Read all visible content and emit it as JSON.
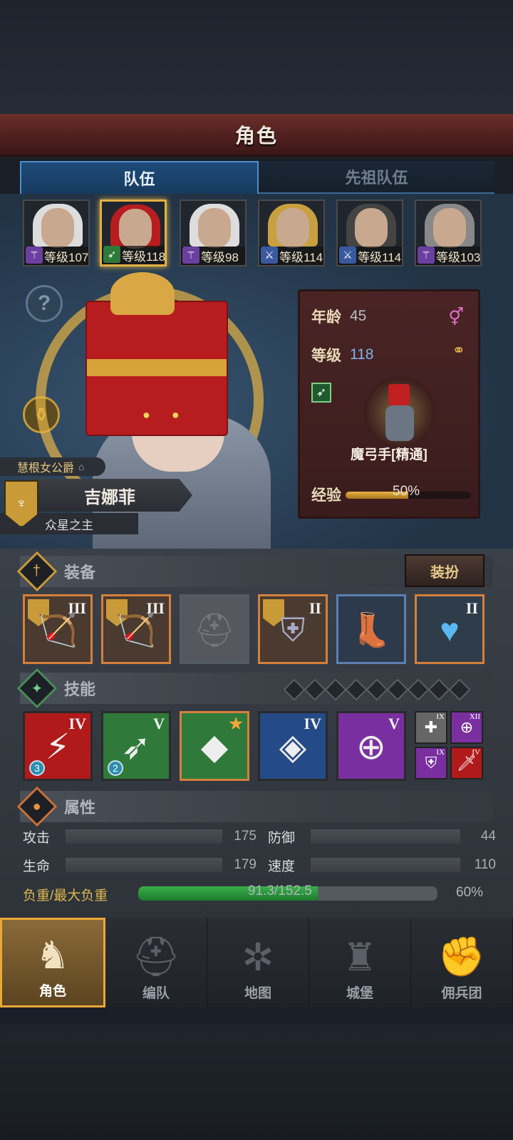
{
  "header": {
    "title": "角色"
  },
  "tabs": [
    {
      "label": "队伍",
      "active": true
    },
    {
      "label": "先祖队伍",
      "active": false
    }
  ],
  "heroes": [
    {
      "level": "等级107",
      "class_icon": "staff-icon",
      "class_color": "#6b3fa0",
      "hair": "#ddd"
    },
    {
      "level": "等级118",
      "class_icon": "bow-icon",
      "class_color": "#2e7a3a",
      "hair": "#b71d1f",
      "selected": true
    },
    {
      "level": "等级98",
      "class_icon": "staff-icon",
      "class_color": "#6b3fa0",
      "hair": "#ddd"
    },
    {
      "level": "等级114",
      "class_icon": "sword-icon",
      "class_color": "#3a5aa0",
      "hair": "#c8a040"
    },
    {
      "level": "等级114",
      "class_icon": "sword-icon",
      "class_color": "#3a5aa0",
      "hair": "#444"
    },
    {
      "level": "等级103",
      "class_icon": "staff-icon",
      "class_color": "#6b3fa0",
      "hair": "#888"
    }
  ],
  "character": {
    "title": "慧根女公爵",
    "name": "吉娜菲",
    "subtitle": "众星之主",
    "age_label": "年龄",
    "age": "45",
    "level_label": "等级",
    "level": "118",
    "class_name": "魔弓手[精通]",
    "exp_label": "经验",
    "exp_percent": 50,
    "exp_text": "50%"
  },
  "equipment": {
    "title": "装备",
    "dress_button": "装扮",
    "slots": [
      {
        "tier": "III",
        "icon": "bow-weapon-icon",
        "type": "orange"
      },
      {
        "tier": "III",
        "icon": "bow-weapon-icon",
        "type": "orange"
      },
      {
        "tier": "",
        "icon": "helmet-icon",
        "type": "empty"
      },
      {
        "tier": "II",
        "icon": "armor-icon",
        "type": "orange"
      },
      {
        "tier": "",
        "icon": "boots-icon",
        "type": "blue"
      },
      {
        "tier": "II",
        "icon": "amulet-icon",
        "type": "orange"
      }
    ]
  },
  "skills": {
    "title": "技能",
    "main": [
      {
        "tier": "IV",
        "icon": "lightning-sword-icon",
        "bg": "#b01a1a",
        "count": "3"
      },
      {
        "tier": "V",
        "icon": "crossbow-icon",
        "bg": "#2f7a3a",
        "count": "2"
      },
      {
        "tier": "",
        "icon": "crystal-spear-icon",
        "bg": "#2f7a3a",
        "count": ""
      },
      {
        "tier": "IV",
        "icon": "crystal-sword-icon",
        "bg": "#254a88",
        "count": ""
      },
      {
        "tier": "V",
        "icon": "target-spear-icon",
        "bg": "#7a2fa0",
        "count": ""
      }
    ],
    "passive": [
      {
        "tier": "IX",
        "icon": "cross-icon",
        "bg": "#666"
      },
      {
        "tier": "XII",
        "icon": "target-icon",
        "bg": "#7a2fa0"
      },
      {
        "tier": "IX",
        "icon": "shield-icon",
        "bg": "#7a2fa0"
      },
      {
        "tier": "IV",
        "icon": "sword-icon",
        "bg": "#b01a1a"
      }
    ]
  },
  "attributes": {
    "title": "属性",
    "attack_label": "攻击",
    "attack": "175",
    "defense_label": "防御",
    "defense": "44",
    "hp_label": "生命",
    "hp": "179",
    "speed_label": "速度",
    "speed": "110",
    "load_label": "负重/最大负重",
    "load_text": "91.3/152.5",
    "load_percent": 60,
    "load_pct_text": "60%"
  },
  "nav": [
    {
      "label": "角色",
      "icon": "knight-icon",
      "active": true
    },
    {
      "label": "编队",
      "icon": "helmet-icon",
      "active": false
    },
    {
      "label": "地图",
      "icon": "compass-icon",
      "active": false
    },
    {
      "label": "城堡",
      "icon": "castle-icon",
      "active": false
    },
    {
      "label": "佣兵团",
      "icon": "fist-icon",
      "active": false
    }
  ]
}
